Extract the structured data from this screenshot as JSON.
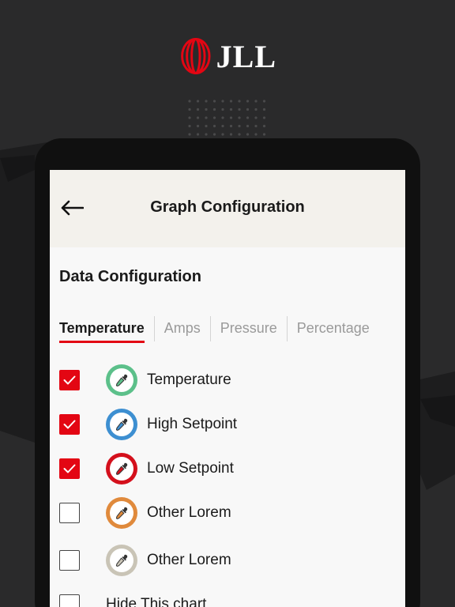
{
  "brand": {
    "logo_text": "JLL",
    "accent_color": "#e30613"
  },
  "header": {
    "title": "Graph Configuration",
    "back_icon": "arrow-left-icon"
  },
  "section": {
    "title": "Data Configuration"
  },
  "tabs": [
    {
      "label": "Temperature",
      "active": true
    },
    {
      "label": "Amps",
      "active": false
    },
    {
      "label": "Pressure",
      "active": false
    },
    {
      "label": "Percentage",
      "active": false
    }
  ],
  "rows": [
    {
      "label": "Temperature",
      "checked": true,
      "color": "#5cc08a",
      "icon": "eyedropper-icon"
    },
    {
      "label": "High Setpoint",
      "checked": true,
      "color": "#3d8fd1",
      "icon": "eyedropper-icon"
    },
    {
      "label": "Low Setpoint",
      "checked": true,
      "color": "#d4101c",
      "icon": "eyedropper-icon"
    },
    {
      "label": "Other Lorem",
      "checked": false,
      "color": "#e08a3c",
      "icon": "eyedropper-icon"
    },
    {
      "label": "Other Lorem",
      "checked": false,
      "color": "#c9c4b6",
      "icon": "eyedropper-icon"
    }
  ],
  "hide_chart": {
    "label": "Hide This chart",
    "checked": false
  }
}
